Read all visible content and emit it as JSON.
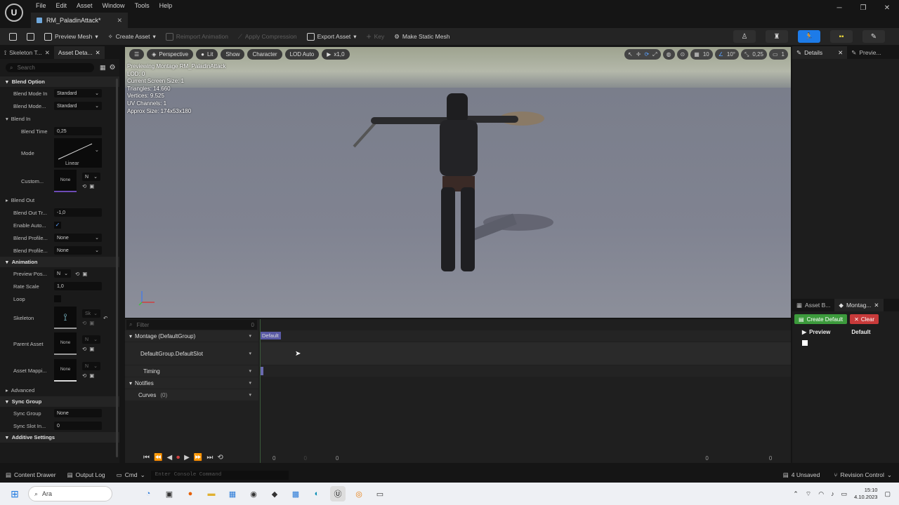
{
  "menu": [
    "File",
    "Edit",
    "Asset",
    "Window",
    "Tools",
    "Help"
  ],
  "doc_tab": "RM_PaladinAttack*",
  "toolbar": {
    "save_icon": "save-icon",
    "items": [
      {
        "label": "Preview Mesh",
        "dim": false
      },
      {
        "label": "Create Asset",
        "dim": false
      },
      {
        "label": "Reimport Animation",
        "dim": true
      },
      {
        "label": "Apply Compression",
        "dim": true
      },
      {
        "label": "Export Asset",
        "dim": false
      },
      {
        "label": "Key",
        "dim": true
      },
      {
        "label": "Make Static Mesh",
        "dim": false
      }
    ]
  },
  "left_tabs": [
    "Skeleton T...",
    "Asset Deta..."
  ],
  "search_placeholder": "Search",
  "details": {
    "blend_option": "Blend Option",
    "blend_mode_in_label": "Blend Mode In",
    "blend_mode_in": "Standard",
    "blend_mode_out_label": "Blend Mode...",
    "blend_mode_out": "Standard",
    "blend_in": "Blend In",
    "blend_time_label": "Blend Time",
    "blend_time": "0,25",
    "mode_label": "Mode",
    "mode_value": "Linear",
    "custom_label": "Custom...",
    "none": "None",
    "n_short": "N",
    "blend_out": "Blend Out",
    "blend_out_trigger_label": "Blend Out Tr...",
    "blend_out_trigger": "-1,0",
    "enable_auto_label": "Enable Auto...",
    "blend_profile_label": "Blend Profile...",
    "animation": "Animation",
    "preview_pos_label": "Preview Pos...",
    "rate_scale_label": "Rate Scale",
    "rate_scale": "1,0",
    "loop_label": "Loop",
    "skeleton_label": "Skeleton",
    "skeleton_short": "Sk",
    "parent_asset_label": "Parent Asset",
    "asset_mapping_label": "Asset Mappi...",
    "advanced": "Advanced",
    "sync_group": "Sync Group",
    "sync_group_label": "Sync Group",
    "sync_slot_label": "Sync Slot In...",
    "sync_slot": "0",
    "additive": "Additive Settings"
  },
  "viewport": {
    "perspective": "Perspective",
    "lit": "Lit",
    "show": "Show",
    "character": "Character",
    "lod_auto": "LOD Auto",
    "speed": "x1,0",
    "stats": [
      "Previewing Montage RM_PaladinAttack",
      "LOD: 0",
      "Current Screen Size: 1",
      "Triangles: 14.660",
      "Vertices: 9.525",
      "UV Channels: 1",
      "Approx Size: 174x53x180"
    ],
    "grid": "10",
    "angle": "10°",
    "scale": "0,25",
    "camera_speed": "1"
  },
  "right_tabs": {
    "details": "Details",
    "preview": "Previe..."
  },
  "montage_tabs": {
    "asset_browser": "Asset B...",
    "montage": "Montag..."
  },
  "montage_panel": {
    "create_default": "Create Default",
    "clear": "Clear",
    "preview": "Preview",
    "default": "Default"
  },
  "sequencer": {
    "filter_placeholder": "Filter",
    "filter_count": "0",
    "tracks": [
      {
        "label": "Montage (DefaultGroup)",
        "indent": false,
        "arrow": true
      },
      {
        "label": "DefaultGroup.DefaultSlot",
        "indent": true,
        "arrow": false
      },
      {
        "label": "Timing",
        "indent": true,
        "arrow": false
      },
      {
        "label": "Notifies",
        "indent": false,
        "arrow": true
      },
      {
        "label": "Curves",
        "indent": true,
        "arrow": false
      }
    ],
    "curves_count": "(0)",
    "default_section": "Default",
    "timeline_numbers": [
      "0",
      "0",
      "0",
      "0",
      "0"
    ]
  },
  "statusbar": {
    "content_drawer": "Content Drawer",
    "output_log": "Output Log",
    "cmd": "Cmd",
    "console_placeholder": "Enter Console Command",
    "unsaved": "4 Unsaved",
    "revision": "Revision Control"
  },
  "taskbar": {
    "search": "Ara",
    "time": "15:10",
    "date": "4.10.2023"
  }
}
